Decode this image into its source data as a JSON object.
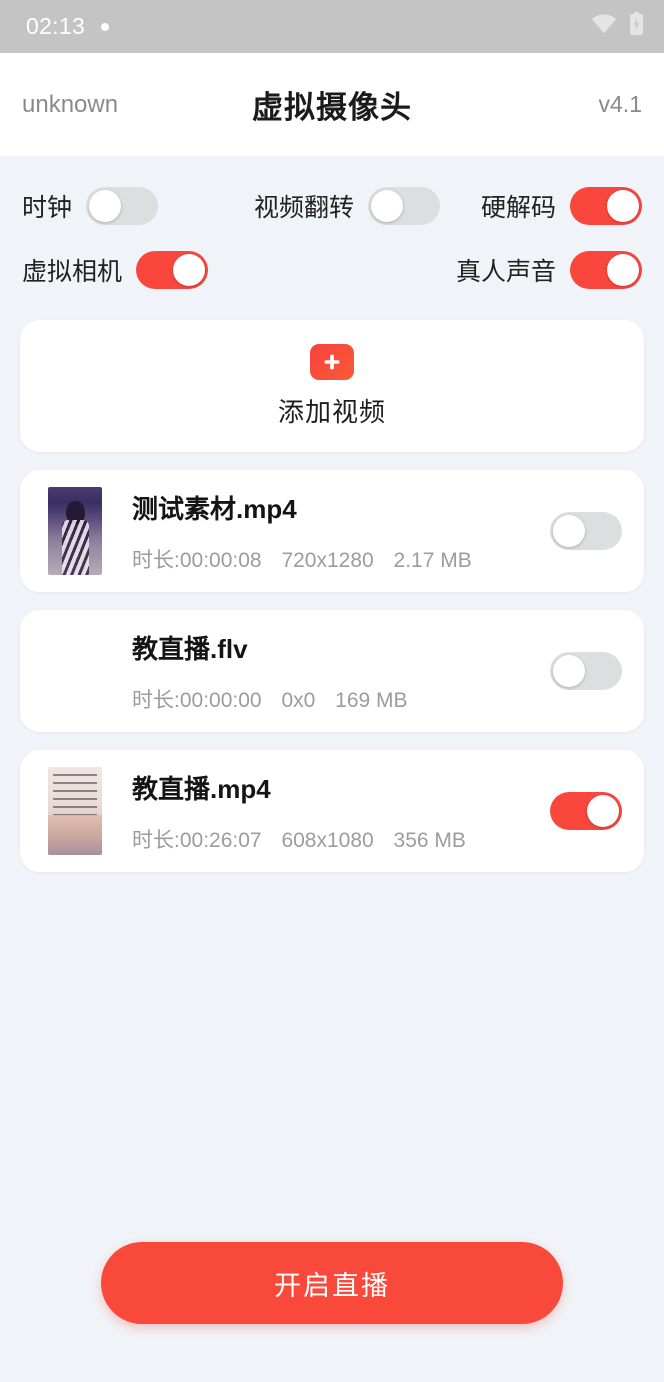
{
  "status_bar": {
    "time": "02:13",
    "notification_dot": "•",
    "wifi_icon": "wifi-icon",
    "battery_icon": "battery-charging-icon",
    "background": "#C4C4C4",
    "foreground": "#FFFFFF"
  },
  "app_bar": {
    "left_label": "unknown",
    "title": "虚拟摄像头",
    "version": "v4.1"
  },
  "theme": {
    "accent": "#F9473E",
    "page_background": "#F0F3F7",
    "card_background": "#FFFFFF",
    "muted_text": "#9C9C9C"
  },
  "switches": [
    {
      "label": "时钟",
      "on": false,
      "name": "clock"
    },
    {
      "label": "视频翻转",
      "on": false,
      "name": "video-flip"
    },
    {
      "label": "硬解码",
      "on": true,
      "name": "hardware-decode"
    },
    {
      "label": "虚拟相机",
      "on": true,
      "name": "virtual-camera"
    },
    {
      "label": "真人声音",
      "on": true,
      "name": "real-voice"
    }
  ],
  "add_video": {
    "icon": "plus-icon",
    "label": "添加视频"
  },
  "video_list": [
    {
      "title": "测试素材.mp4",
      "duration": "时长:00:00:08",
      "resolution": "720x1280",
      "size": "2.17 MB",
      "on": false,
      "thumbnail": "thumbnail-dark-purple"
    },
    {
      "title": "教直播.flv",
      "duration": "时长:00:00:00",
      "resolution": "0x0",
      "size": "169 MB",
      "on": false,
      "thumbnail": "thumbnail-none"
    },
    {
      "title": "教直播.mp4",
      "duration": "时长:00:26:07",
      "resolution": "608x1080",
      "size": "356 MB",
      "on": true,
      "thumbnail": "thumbnail-beige-note"
    }
  ],
  "bottom": {
    "start_live_label": "开启直播"
  }
}
